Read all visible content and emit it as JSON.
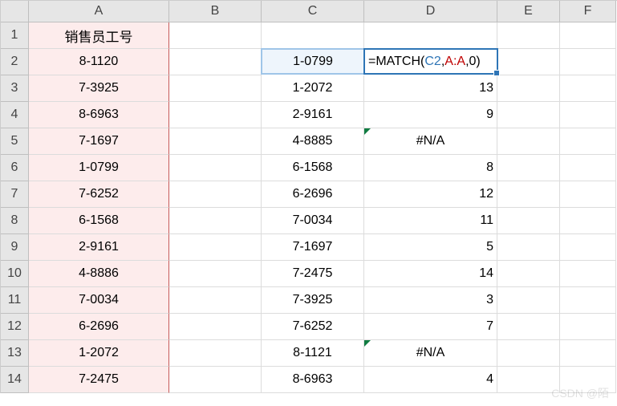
{
  "col_headers": [
    "A",
    "B",
    "C",
    "D",
    "E",
    "F"
  ],
  "row_headers": [
    "1",
    "2",
    "3",
    "4",
    "5",
    "6",
    "7",
    "8",
    "9",
    "10",
    "11",
    "12",
    "13",
    "14"
  ],
  "colA_header": "销售员工号",
  "colA": [
    "8-1120",
    "7-3925",
    "8-6963",
    "7-1697",
    "1-0799",
    "7-6252",
    "6-1568",
    "2-9161",
    "4-8886",
    "7-0034",
    "6-2696",
    "1-2072",
    "7-2475"
  ],
  "colC": [
    "1-0799",
    "1-2072",
    "2-9161",
    "4-8885",
    "6-1568",
    "6-2696",
    "7-0034",
    "7-1697",
    "7-2475",
    "7-3925",
    "7-6252",
    "8-1121",
    "8-6963"
  ],
  "colD": [
    "",
    "13",
    "9",
    "#N/A",
    "8",
    "12",
    "11",
    "5",
    "14",
    "3",
    "7",
    "#N/A",
    "4"
  ],
  "formula_parts": {
    "eq": "=MATCH(",
    "ref1": "C2",
    "c1": ",",
    "ref2": "A:A",
    "c2": ",0)"
  },
  "watermark": "CSDN @陌"
}
